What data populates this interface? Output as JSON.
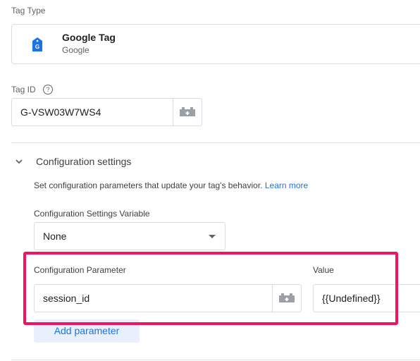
{
  "tag_type": {
    "label": "Tag Type",
    "name": "Google Tag",
    "vendor": "Google",
    "icon": "google-tag-icon"
  },
  "tag_id": {
    "label": "Tag ID",
    "value": "G-VSW03W7WS4",
    "help_icon": "help-icon",
    "variable_icon": "variable-brick-icon"
  },
  "config": {
    "title": "Configuration settings",
    "description": "Set configuration parameters that update your tag's behavior.",
    "learn_more": "Learn more",
    "settings_variable_label": "Configuration Settings Variable",
    "settings_variable_value": "None",
    "param_label": "Configuration Parameter",
    "value_label": "Value",
    "param_value": "session_id",
    "value_value": "{{Undefined}}",
    "add_parameter": "Add parameter"
  },
  "colors": {
    "accent": "#1a73e8",
    "highlight": "#f0155d"
  }
}
